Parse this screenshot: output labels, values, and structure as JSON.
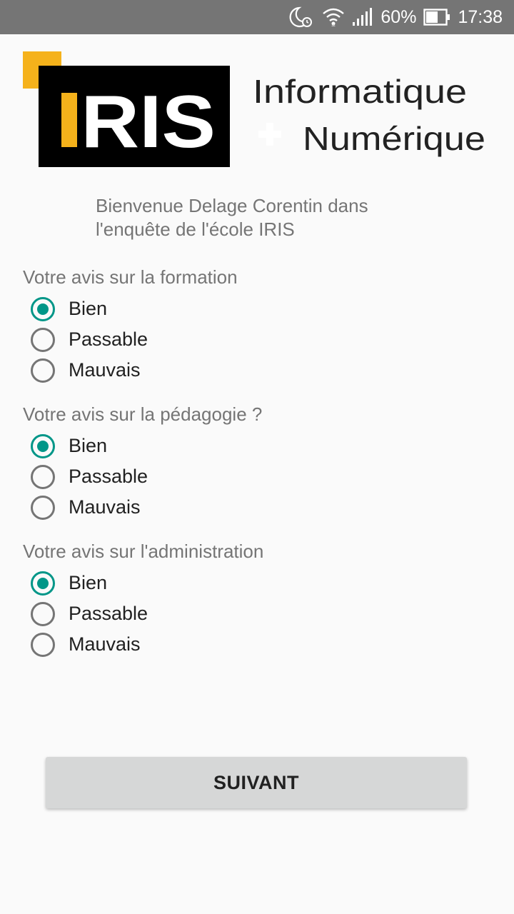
{
  "status_bar": {
    "battery": "60%",
    "time": "17:38",
    "icons": [
      "moon-alarm-icon",
      "wifi-icon",
      "signal-icon",
      "battery-icon"
    ]
  },
  "logo": {
    "brand": "IRIS",
    "line1": "Informatique",
    "line2": "Numérique"
  },
  "welcome_text": "Bienvenue Delage Corentin dans l'enquête de l'école IRIS",
  "questions": [
    {
      "label": "Votre avis sur la formation",
      "options": [
        "Bien",
        "Passable",
        "Mauvais"
      ],
      "selected": "Bien"
    },
    {
      "label": "Votre avis sur la pédagogie ?",
      "options": [
        "Bien",
        "Passable",
        "Mauvais"
      ],
      "selected": "Bien"
    },
    {
      "label": "Votre avis sur l'administration",
      "options": [
        "Bien",
        "Passable",
        "Mauvais"
      ],
      "selected": "Bien"
    }
  ],
  "next_button_label": "SUIVANT",
  "colors": {
    "accent": "#009688",
    "status_bar": "#757575",
    "logo_yellow": "#f5b21b",
    "button": "#d6d7d7"
  }
}
